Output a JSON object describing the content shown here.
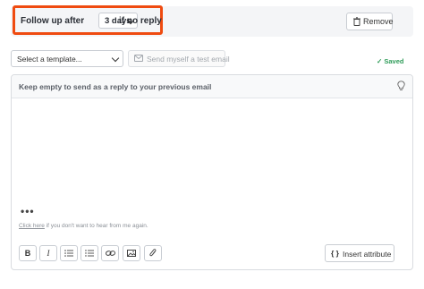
{
  "followup": {
    "prefix": "Follow up after",
    "delay_value": "3 days",
    "suffix": "if no reply"
  },
  "remove_button": {
    "label": "Remove",
    "icon": "trash-icon"
  },
  "template_select": {
    "value": "Select a template..."
  },
  "test_email_button": {
    "label": "Send myself a test email",
    "icon": "envelope-icon"
  },
  "save_status": {
    "label": "✓ Saved",
    "color": "#2f9c59"
  },
  "editor": {
    "subject_placeholder": "Keep empty to send as a reply to your previous email",
    "body_dots": "•••",
    "unsubscribe_link": "Click here",
    "unsubscribe_text": " if you don't want to hear from me again."
  },
  "toolbar": {
    "buttons": [
      "bold",
      "italic",
      "bulleted-list",
      "numbered-list",
      "link",
      "image",
      "attachment"
    ],
    "bold_label": "B",
    "italic_label": "I",
    "insert_attribute_icon": "{ }",
    "insert_attribute_label": "Insert attribute"
  },
  "colors": {
    "highlight_border": "#ef4b10",
    "saved_green": "#2f9c59"
  }
}
